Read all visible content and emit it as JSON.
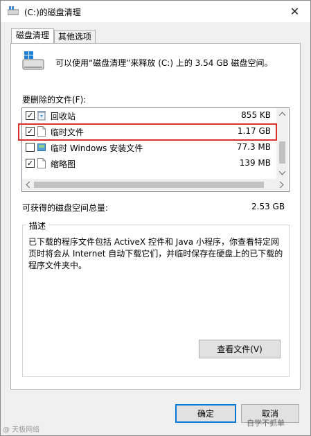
{
  "window": {
    "title": "(C:)的磁盘清理",
    "close_glyph": "✕"
  },
  "tabs": [
    {
      "label": "磁盘清理",
      "active": true
    },
    {
      "label": "其他选项",
      "active": false
    }
  ],
  "intro_text": "可以使用“磁盘清理”来释放 (C:) 上的 3.54 GB 磁盘空间。",
  "files_label": "要删除的文件(F):",
  "files": [
    {
      "checked": true,
      "icon": "recycle-bin-icon",
      "name": "回收站",
      "size": "855 KB"
    },
    {
      "checked": true,
      "icon": "file-icon",
      "name": "临时文件",
      "size": "1.17 GB"
    },
    {
      "checked": false,
      "icon": "windows-setup-icon",
      "name": "临时 Windows 安装文件",
      "size": "77.3 MB"
    },
    {
      "checked": true,
      "icon": "file-icon",
      "name": "缩略图",
      "size": "139 MB"
    }
  ],
  "gain": {
    "label": "可获得的磁盘空间总量:",
    "value": "2.53 GB"
  },
  "description": {
    "title": "描述",
    "text": "已下载的程序文件包括 ActiveX 控件和 Java 小程序，你查看特定网页时将会从 Internet 自动下载它们，并临时保存在硬盘上的已下载的程序文件夹中。"
  },
  "buttons": {
    "view_files": "查看文件(V)",
    "ok": "确定",
    "cancel": "取消"
  },
  "watermarks": {
    "left": "@ 天极网络",
    "right": "自学不抓单"
  },
  "colors": {
    "highlight": "#d9312c",
    "accent": "#0078d7"
  }
}
